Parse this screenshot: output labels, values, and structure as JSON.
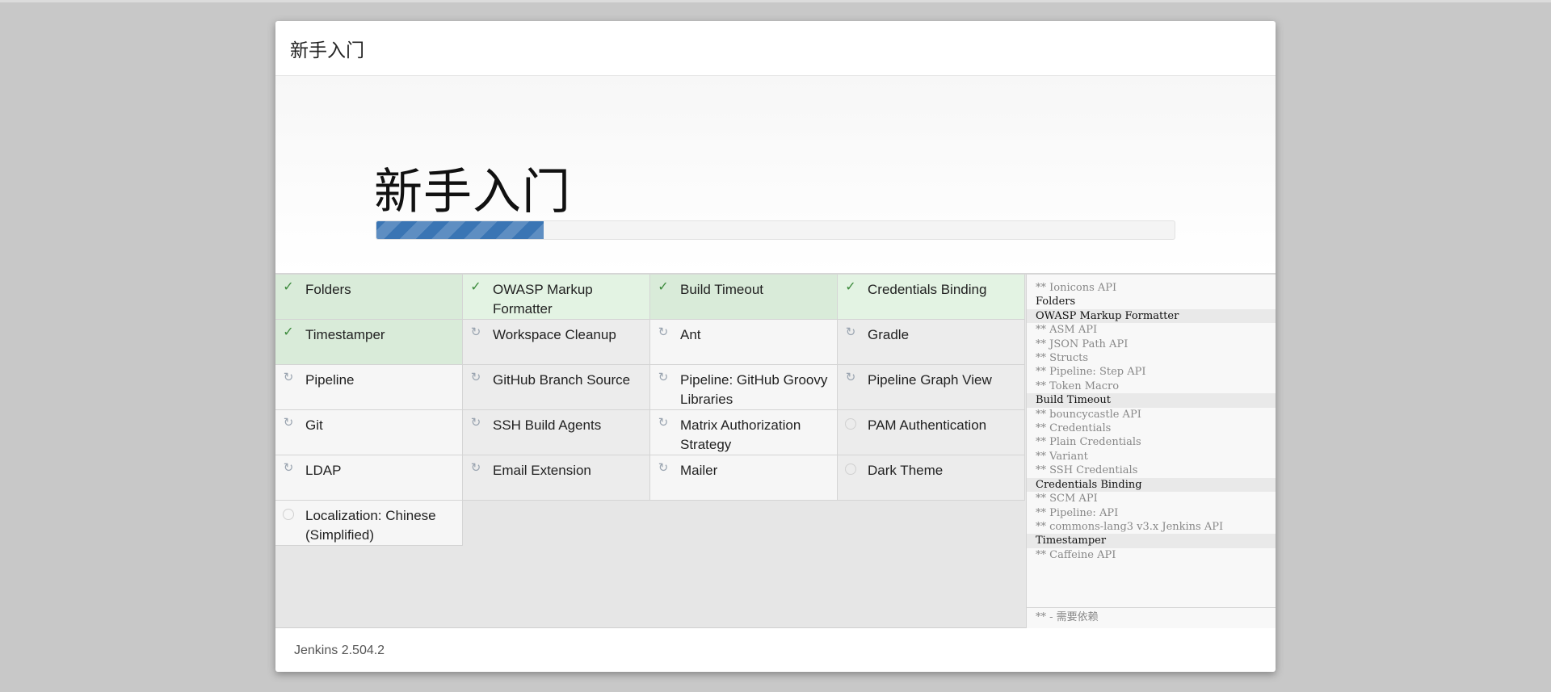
{
  "header": {
    "title": "新手入门"
  },
  "hero": {
    "title": "新手入门",
    "progress_percent": 21
  },
  "plugins": [
    {
      "name": "Folders",
      "status": "success"
    },
    {
      "name": "OWASP Markup Formatter",
      "status": "success"
    },
    {
      "name": "Build Timeout",
      "status": "success"
    },
    {
      "name": "Credentials Binding",
      "status": "success"
    },
    {
      "name": "Timestamper",
      "status": "success"
    },
    {
      "name": "Workspace Cleanup",
      "status": "installing"
    },
    {
      "name": "Ant",
      "status": "installing"
    },
    {
      "name": "Gradle",
      "status": "installing"
    },
    {
      "name": "Pipeline",
      "status": "installing"
    },
    {
      "name": "GitHub Branch Source",
      "status": "installing"
    },
    {
      "name": "Pipeline: GitHub Groovy Libraries",
      "status": "installing"
    },
    {
      "name": "Pipeline Graph View",
      "status": "installing"
    },
    {
      "name": "Git",
      "status": "installing"
    },
    {
      "name": "SSH Build Agents",
      "status": "installing"
    },
    {
      "name": "Matrix Authorization Strategy",
      "status": "installing"
    },
    {
      "name": "PAM Authentication",
      "status": "pending"
    },
    {
      "name": "LDAP",
      "status": "installing"
    },
    {
      "name": "Email Extension",
      "status": "installing"
    },
    {
      "name": "Mailer",
      "status": "installing"
    },
    {
      "name": "Dark Theme",
      "status": "pending"
    },
    {
      "name": "Localization: Chinese (Simplified)",
      "status": "pending"
    }
  ],
  "log": {
    "lines": [
      {
        "text": "** Ionicons API",
        "type": "dep"
      },
      {
        "text": "Folders",
        "type": "main"
      },
      {
        "text": "OWASP Markup Formatter",
        "type": "main",
        "shaded": true
      },
      {
        "text": "** ASM API",
        "type": "dep"
      },
      {
        "text": "** JSON Path API",
        "type": "dep"
      },
      {
        "text": "** Structs",
        "type": "dep"
      },
      {
        "text": "** Pipeline: Step API",
        "type": "dep"
      },
      {
        "text": "** Token Macro",
        "type": "dep"
      },
      {
        "text": "Build Timeout",
        "type": "main",
        "shaded": true
      },
      {
        "text": "** bouncycastle API",
        "type": "dep"
      },
      {
        "text": "** Credentials",
        "type": "dep"
      },
      {
        "text": "** Plain Credentials",
        "type": "dep"
      },
      {
        "text": "** Variant",
        "type": "dep"
      },
      {
        "text": "** SSH Credentials",
        "type": "dep"
      },
      {
        "text": "Credentials Binding",
        "type": "main",
        "shaded": true
      },
      {
        "text": "** SCM API",
        "type": "dep"
      },
      {
        "text": "** Pipeline: API",
        "type": "dep"
      },
      {
        "text": "** commons-lang3 v3.x Jenkins API",
        "type": "dep"
      },
      {
        "text": "Timestamper",
        "type": "main",
        "shaded": true
      },
      {
        "text": "** Caffeine API",
        "type": "dep"
      }
    ],
    "legend": "** - 需要依赖"
  },
  "footer": {
    "version": "Jenkins 2.504.2"
  },
  "icons": {
    "success": "✓",
    "installing": "↻",
    "pending": ""
  },
  "colors": {
    "progress": "#3a75b4",
    "success_bg": "#d9ebd9",
    "success_check": "#3d8b3d"
  }
}
